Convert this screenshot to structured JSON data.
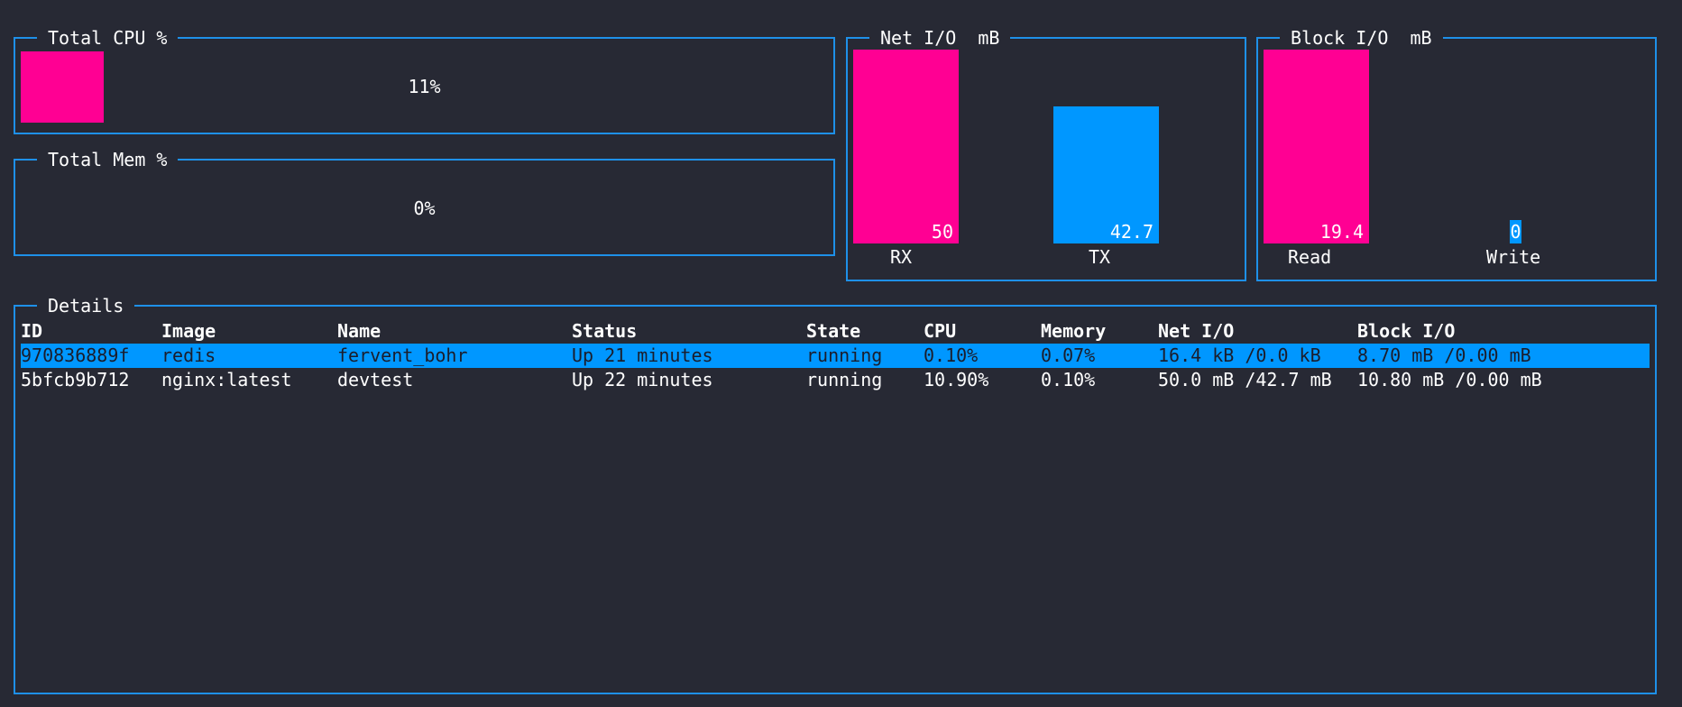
{
  "colors": {
    "background": "#272934",
    "border": "#1e90e8",
    "pink": "#ff0093",
    "blue": "#0097ff",
    "selected_text": "#1b1d2b"
  },
  "cpu": {
    "title": "Total CPU %",
    "value_label": "11%",
    "fraction": 0.11
  },
  "mem": {
    "title": "Total Mem %",
    "value_label": "0%",
    "fraction": 0.0
  },
  "net": {
    "title": "Net I/O  mB",
    "rx": {
      "label": "RX",
      "value": "50",
      "amount": 50
    },
    "tx": {
      "label": "TX",
      "value": "42.7",
      "amount": 42.7
    }
  },
  "block": {
    "title": "Block I/O  mB",
    "read": {
      "label": "Read",
      "value": "19.4",
      "amount": 19.4
    },
    "write": {
      "label": "Write",
      "value": "0",
      "amount": 0
    }
  },
  "details": {
    "title": "Details",
    "headers": [
      "ID",
      "Image",
      "Name",
      "Status",
      "State",
      "CPU",
      "Memory",
      "Net I/O",
      "Block I/O"
    ],
    "rows": [
      [
        "970836889f",
        "redis",
        "fervent_bohr",
        "Up 21 minutes",
        "running",
        "0.10%",
        "0.07%",
        "16.4 kB /0.0 kB",
        "8.70 mB /0.00 mB"
      ],
      [
        "5bfcb9b712",
        "nginx:latest",
        "devtest",
        "Up 22 minutes",
        "running",
        "10.90%",
        "0.10%",
        "50.0 mB /42.7 mB",
        "10.80 mB /0.00 mB"
      ]
    ],
    "selected_row": 0
  }
}
